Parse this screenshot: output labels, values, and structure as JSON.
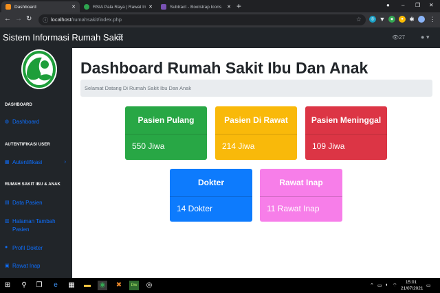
{
  "browser": {
    "tabs": [
      {
        "label": "Dashboard",
        "favicon_color": "#f4901e",
        "active": true
      },
      {
        "label": "RSIA Pala Raya | Rawat Inap",
        "favicon_color": "#2ea44f",
        "active": false
      },
      {
        "label": "Subtract - Bootstrap Icons",
        "favicon_color": "#7952b3",
        "active": false
      }
    ],
    "url_host": "localhost",
    "url_path": "/rumahsakit/index.php",
    "profile_badge": "2"
  },
  "navbar": {
    "brand": "Sistem Informasi Rumah Sakit",
    "views_count": "27"
  },
  "sidebar": {
    "sections": [
      {
        "heading": "DASHBOARD",
        "items": [
          {
            "label": "Dashboard",
            "icon": "speedometer-icon"
          }
        ]
      },
      {
        "heading": "AUTENTIFIKASI USER",
        "items": [
          {
            "label": "Autentifikasi",
            "icon": "columns-icon"
          }
        ]
      },
      {
        "heading": "RUMAH SAKIT IBU & ANAK",
        "items": [
          {
            "label": "Data Pasien",
            "icon": "table-icon"
          },
          {
            "label": "Halaman Tambah Pasien",
            "icon": "book-icon"
          },
          {
            "label": "Profil Dokter",
            "icon": "users-icon"
          },
          {
            "label": "Rawat Inap",
            "icon": "hospital-icon"
          }
        ]
      }
    ]
  },
  "main": {
    "title": "Dashboard Rumah Sakit Ibu Dan Anak",
    "breadcrumb": "Selamat Datang Di Rumah Sakit Ibu Dan Anak",
    "cards": [
      {
        "title": "Pasien Pulang",
        "value": "550 Jiwa",
        "color": "#28a745"
      },
      {
        "title": "Pasien Di Rawat",
        "value": "214 Jiwa",
        "color": "#f9b90a"
      },
      {
        "title": "Pasien Meninggal",
        "value": "109 Jiwa",
        "color": "#dc3545"
      },
      {
        "title": "Dokter",
        "value": "14 Dokter",
        "color": "#0d7bfd"
      },
      {
        "title": "Rawat Inap",
        "value": "11 Rawat Inap",
        "color": "#f77ee9"
      }
    ]
  },
  "taskbar": {
    "time": "15:01",
    "date": "21/07/2021"
  }
}
